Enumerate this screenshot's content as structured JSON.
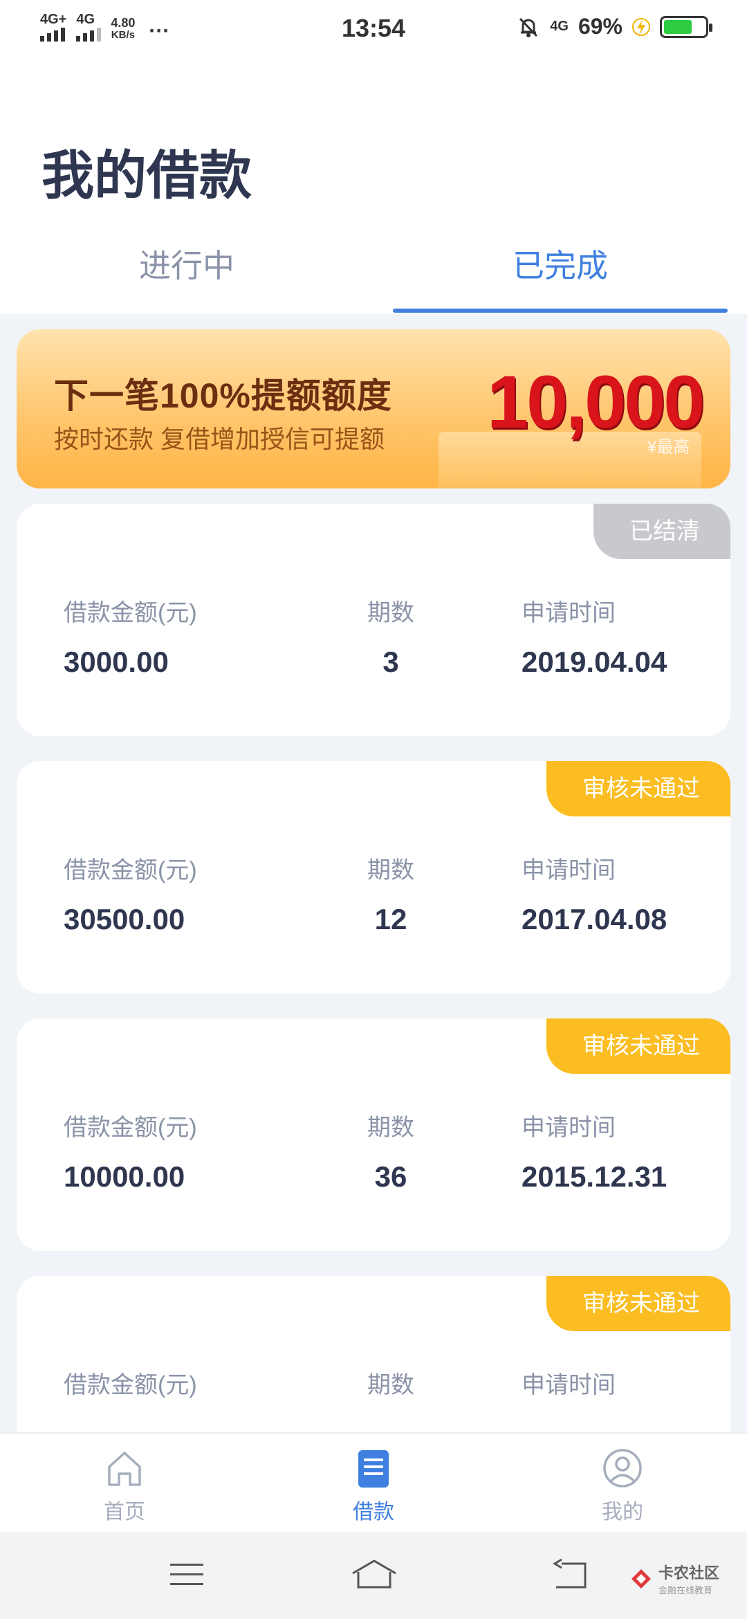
{
  "status_bar": {
    "sim1": "4G+",
    "sim2": "4G",
    "speed_value": "4.80",
    "speed_unit": "KB/s",
    "more": "···",
    "time": "13:54",
    "network": "4G",
    "battery_percent": "69%",
    "battery_level": 0.69
  },
  "header": {
    "title": "我的借款",
    "tabs": [
      {
        "label": "进行中",
        "active": false
      },
      {
        "label": "已完成",
        "active": true
      }
    ]
  },
  "banner": {
    "title": "下一笔100%提额额度",
    "subtitle": "按时还款  复借增加授信可提额",
    "amount": "10,000",
    "note": "¥最高"
  },
  "loans": [
    {
      "status": "已结清",
      "status_color": "#c8c9cd",
      "amount_label": "借款金额(元)",
      "amount": "3000.00",
      "periods_label": "期数",
      "periods": "3",
      "date_label": "申请时间",
      "date": "2019.04.04"
    },
    {
      "status": "审核未通过",
      "status_color": "#fbbd22",
      "amount_label": "借款金额(元)",
      "amount": "30500.00",
      "periods_label": "期数",
      "periods": "12",
      "date_label": "申请时间",
      "date": "2017.04.08"
    },
    {
      "status": "审核未通过",
      "status_color": "#fbbd22",
      "amount_label": "借款金额(元)",
      "amount": "10000.00",
      "periods_label": "期数",
      "periods": "36",
      "date_label": "申请时间",
      "date": "2015.12.31"
    },
    {
      "status": "审核未通过",
      "status_color": "#fbbd22",
      "amount_label": "借款金额(元)",
      "amount": "",
      "periods_label": "期数",
      "periods": "",
      "date_label": "申请时间",
      "date": ""
    }
  ],
  "bottom_nav": [
    {
      "label": "首页",
      "icon": "home-icon",
      "active": false
    },
    {
      "label": "借款",
      "icon": "document-icon",
      "active": true
    },
    {
      "label": "我的",
      "icon": "user-icon",
      "active": false
    }
  ],
  "system_nav": {
    "icons": [
      "menu-icon",
      "home-outline-icon",
      "back-icon"
    ]
  },
  "watermark": {
    "text": "卡农社区",
    "subtext": "金融在线教育"
  },
  "colors": {
    "accent": "#3f7fe0",
    "title": "#2e3650",
    "muted": "#8a93a8",
    "banner_red": "#d9141b"
  }
}
